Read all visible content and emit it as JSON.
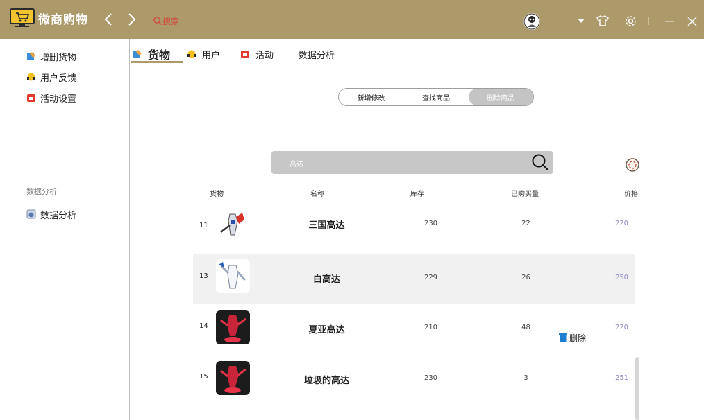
{
  "app": {
    "title": "微商购物"
  },
  "topbar": {
    "search_placeholder": "搜索"
  },
  "sidebar": {
    "items": [
      {
        "label": "增删货物"
      },
      {
        "label": "用户反馈"
      },
      {
        "label": "活动设置"
      }
    ],
    "section_title": "数据分析",
    "section_items": [
      {
        "label": "数据分析"
      }
    ]
  },
  "tabs": [
    {
      "label": "货物",
      "active": true
    },
    {
      "label": "用户"
    },
    {
      "label": "活动"
    },
    {
      "label": "数据分析"
    }
  ],
  "segmented": {
    "options": [
      "新增修改",
      "查找商品",
      "删除商品"
    ],
    "selected": "删除商品"
  },
  "product_search": {
    "value": "高达"
  },
  "table": {
    "headers": [
      "货物",
      "名称",
      "库存",
      "已购买量",
      "价格"
    ],
    "rows": [
      {
        "id": "11",
        "name": "三国高达",
        "stock": "230",
        "bought": "22",
        "price": "220"
      },
      {
        "id": "13",
        "name": "白高达",
        "stock": "229",
        "bought": "26",
        "price": "250"
      },
      {
        "id": "14",
        "name": "夏亚高达",
        "stock": "210",
        "bought": "48",
        "price": "220"
      },
      {
        "id": "15",
        "name": "垃圾的高达",
        "stock": "230",
        "bought": "3",
        "price": "251"
      }
    ]
  },
  "row_action": {
    "delete_label": "删除"
  },
  "colors": {
    "titlebar": "#ad9a6b",
    "price": "#8f8cc9",
    "accent_underline": "#ad9a6b"
  },
  "icons": {
    "logo": "shop-monitor-icon",
    "back": "chevron-left-icon",
    "forward": "chevron-right-icon",
    "search": "search-icon",
    "menu": "caret-down-icon",
    "skin": "tshirt-icon",
    "settings": "gear-icon",
    "minimize": "minimize-icon",
    "close": "close-icon",
    "refresh": "refresh-icon",
    "delete": "trash-icon"
  }
}
